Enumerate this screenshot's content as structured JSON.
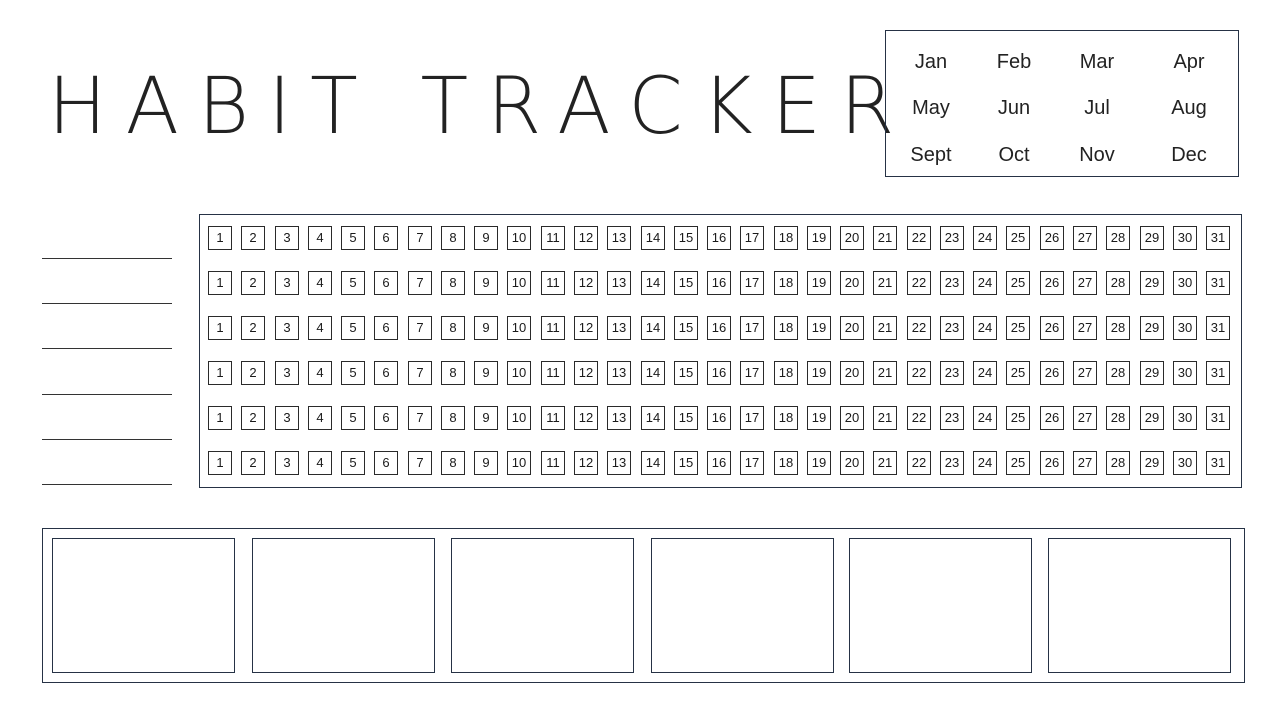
{
  "title": "HABIT TRACKER",
  "months": [
    "Jan",
    "Feb",
    "Mar",
    "Apr",
    "May",
    "Jun",
    "Jul",
    "Aug",
    "Sept",
    "Oct",
    "Nov",
    "Dec"
  ],
  "habit_rows": [
    {
      "label": "",
      "days": [
        "1",
        "2",
        "3",
        "4",
        "5",
        "6",
        "7",
        "8",
        "9",
        "10",
        "11",
        "12",
        "13",
        "14",
        "15",
        "16",
        "17",
        "18",
        "19",
        "20",
        "21",
        "22",
        "23",
        "24",
        "25",
        "26",
        "27",
        "28",
        "29",
        "30",
        "31"
      ]
    },
    {
      "label": "",
      "days": [
        "1",
        "2",
        "3",
        "4",
        "5",
        "6",
        "7",
        "8",
        "9",
        "10",
        "11",
        "12",
        "13",
        "14",
        "15",
        "16",
        "17",
        "18",
        "19",
        "20",
        "21",
        "22",
        "23",
        "24",
        "25",
        "26",
        "27",
        "28",
        "29",
        "30",
        "31"
      ]
    },
    {
      "label": "",
      "days": [
        "1",
        "2",
        "3",
        "4",
        "5",
        "6",
        "7",
        "8",
        "9",
        "10",
        "11",
        "12",
        "13",
        "14",
        "15",
        "16",
        "17",
        "18",
        "19",
        "20",
        "21",
        "22",
        "23",
        "24",
        "25",
        "26",
        "27",
        "28",
        "29",
        "30",
        "31"
      ]
    },
    {
      "label": "",
      "days": [
        "1",
        "2",
        "3",
        "4",
        "5",
        "6",
        "7",
        "8",
        "9",
        "10",
        "11",
        "12",
        "13",
        "14",
        "15",
        "16",
        "17",
        "18",
        "19",
        "20",
        "21",
        "22",
        "23",
        "24",
        "25",
        "26",
        "27",
        "28",
        "29",
        "30",
        "31"
      ]
    },
    {
      "label": "",
      "days": [
        "1",
        "2",
        "3",
        "4",
        "5",
        "6",
        "7",
        "8",
        "9",
        "10",
        "11",
        "12",
        "13",
        "14",
        "15",
        "16",
        "17",
        "18",
        "19",
        "20",
        "21",
        "22",
        "23",
        "24",
        "25",
        "26",
        "27",
        "28",
        "29",
        "30",
        "31"
      ]
    },
    {
      "label": "",
      "days": [
        "1",
        "2",
        "3",
        "4",
        "5",
        "6",
        "7",
        "8",
        "9",
        "10",
        "11",
        "12",
        "13",
        "14",
        "15",
        "16",
        "17",
        "18",
        "19",
        "20",
        "21",
        "22",
        "23",
        "24",
        "25",
        "26",
        "27",
        "28",
        "29",
        "30",
        "31"
      ]
    }
  ],
  "note_boxes": [
    "",
    "",
    "",
    "",
    "",
    ""
  ],
  "colors": {
    "border": "#263245",
    "text": "#222222"
  }
}
